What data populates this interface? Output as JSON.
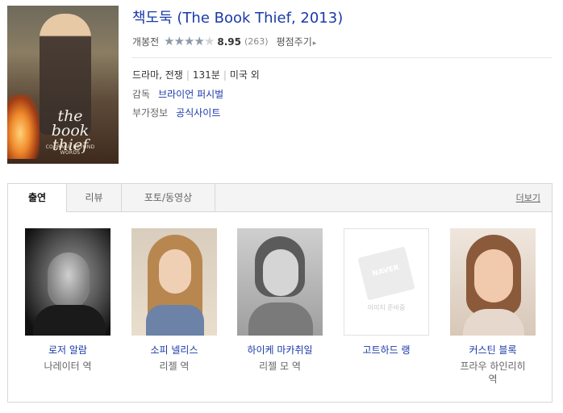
{
  "movie": {
    "title": "책도둑 (The Book Thief, 2013)",
    "status": "개봉전",
    "rating": 8.95,
    "rating_text": "8.95",
    "rating_count": "(263)",
    "rating_stars_filled": 4,
    "rate_link": "평점주기",
    "genre": "드라마, 전쟁",
    "runtime": "131분",
    "country": "미국 외",
    "director_label": "감독",
    "director": "브라이언 퍼시벌",
    "extra_label": "부가정보",
    "extra_link": "공식사이트"
  },
  "poster": {
    "title_line1": "the",
    "title_line2": "book",
    "title_line3": "thief",
    "tagline": "COURAGE BEYOND WORDS"
  },
  "tabs": [
    {
      "label": "출연",
      "active": true
    },
    {
      "label": "리뷰",
      "active": false
    },
    {
      "label": "포토/동영상",
      "active": false
    }
  ],
  "more_link": "더보기",
  "cast": [
    {
      "name": "로저 알람",
      "role": "나레이터 역"
    },
    {
      "name": "소피 넬리스",
      "role": "리젤 역"
    },
    {
      "name": "하이케 마카취일",
      "role": "리젤 모 역"
    },
    {
      "name": "고트하드 랭",
      "role": "",
      "placeholder_logo": "NAVER",
      "placeholder_text": "이미지 준비중"
    },
    {
      "name": "커스틴 블록",
      "role": "프라우 하인리히 역"
    }
  ],
  "colors": {
    "link": "#1a3aa8",
    "star": "#8d9aa8"
  }
}
